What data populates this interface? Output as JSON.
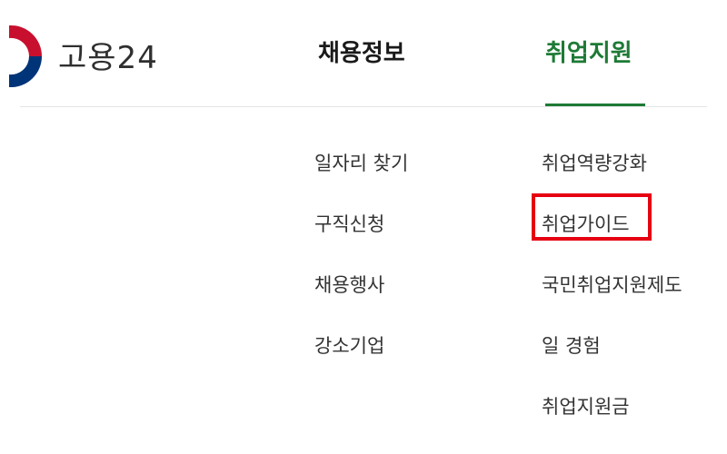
{
  "header": {
    "logo_text": "고용24",
    "logo_icon": "taegeuk-emblem-icon",
    "nav": [
      {
        "label": "채용정보"
      },
      {
        "label": "취업지원"
      }
    ],
    "active_color": "#1e7a36"
  },
  "menu": {
    "jobs": [
      {
        "label": "일자리 찾기"
      },
      {
        "label": "구직신청"
      },
      {
        "label": "채용행사"
      },
      {
        "label": "강소기업"
      }
    ],
    "support": [
      {
        "label": "취업역량강화"
      },
      {
        "label": "취업가이드"
      },
      {
        "label": "국민취업지원제도"
      },
      {
        "label": "일 경험"
      },
      {
        "label": "취업지원금"
      }
    ]
  },
  "highlight": {
    "target": "취업가이드",
    "color": "#e60012"
  }
}
